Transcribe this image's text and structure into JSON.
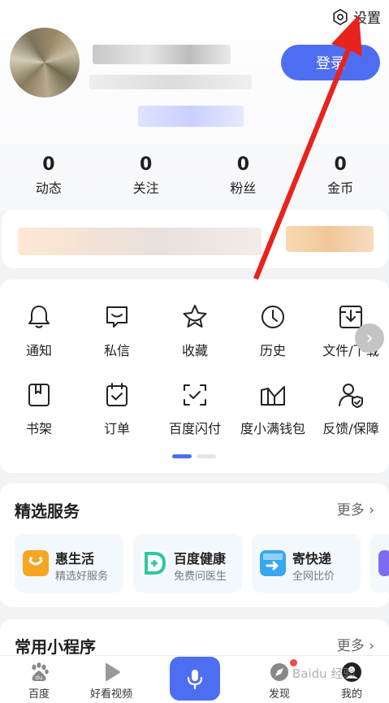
{
  "header": {
    "settings_label": "设置",
    "login_label": "登录"
  },
  "stats": [
    {
      "value": "0",
      "label": "动态"
    },
    {
      "value": "0",
      "label": "关注"
    },
    {
      "value": "0",
      "label": "粉丝"
    },
    {
      "value": "0",
      "label": "金币"
    }
  ],
  "tools": {
    "row1": [
      {
        "label": "通知",
        "icon": "bell-icon"
      },
      {
        "label": "私信",
        "icon": "message-icon"
      },
      {
        "label": "收藏",
        "icon": "star-icon"
      },
      {
        "label": "历史",
        "icon": "clock-icon"
      },
      {
        "label": "文件/下载",
        "icon": "download-icon"
      }
    ],
    "row2": [
      {
        "label": "书架",
        "icon": "bookshelf-icon"
      },
      {
        "label": "订单",
        "icon": "order-icon"
      },
      {
        "label": "百度闪付",
        "icon": "scan-pay-icon"
      },
      {
        "label": "度小满钱包",
        "icon": "wallet-icon"
      },
      {
        "label": "反馈/保障",
        "icon": "feedback-icon"
      }
    ],
    "next_glyph": "›"
  },
  "services": {
    "title": "精选服务",
    "more": "更多",
    "cards": [
      {
        "title": "惠生活",
        "subtitle": "精选好服务",
        "color": "#f5a623"
      },
      {
        "title": "百度健康",
        "subtitle": "免费问医生",
        "color": "#2ec7a3"
      },
      {
        "title": "寄快递",
        "subtitle": "全网比价",
        "color": "#3aa6ee"
      }
    ]
  },
  "mini_programs": {
    "title": "常用小程序",
    "more": "更多"
  },
  "tabbar": [
    {
      "label": "百度",
      "icon": "baidu-paw-icon"
    },
    {
      "label": "好看视频",
      "icon": "play-icon"
    },
    {
      "label": "",
      "icon": "microphone-icon"
    },
    {
      "label": "发现",
      "icon": "compass-icon"
    },
    {
      "label": "我的",
      "icon": "profile-icon"
    }
  ],
  "watermark": "Baidu 经验",
  "colors": {
    "accent": "#4e6ef2",
    "annotation_arrow": "#e8231c",
    "badge": "#f04a4a"
  }
}
